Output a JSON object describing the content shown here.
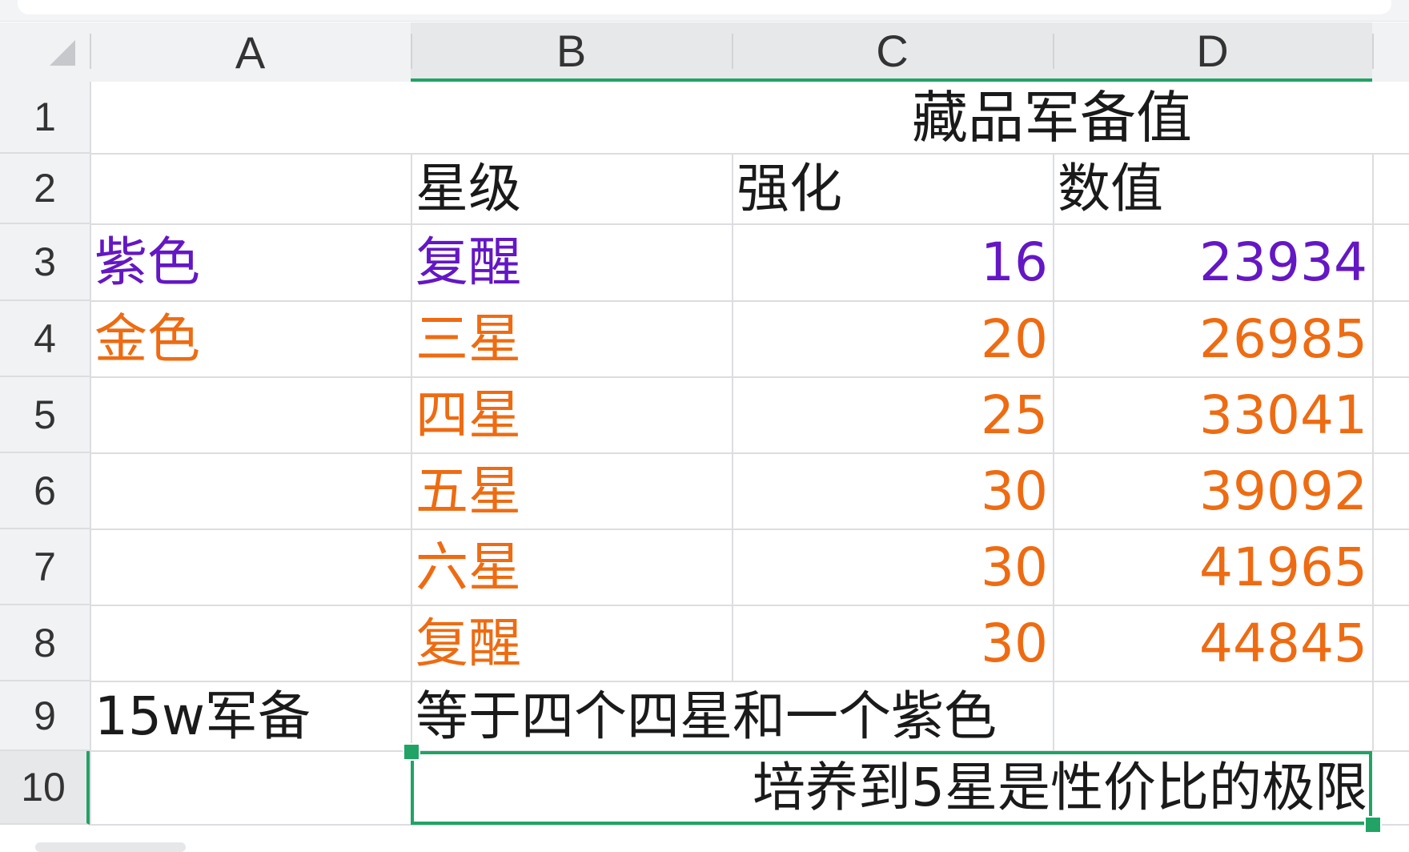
{
  "spreadsheet": {
    "columns": [
      "A",
      "B",
      "C",
      "D"
    ],
    "rows": [
      "1",
      "2",
      "3",
      "4",
      "5",
      "6",
      "7",
      "8",
      "9",
      "10"
    ],
    "selected_range": "B10:D10",
    "cells": {
      "title_merged_C1_D1": "藏品军备值",
      "B2": "星级",
      "C2": "强化",
      "D2": "数值",
      "A3": "紫色",
      "B3": "复醒",
      "C3": "16",
      "D3": "23934",
      "A4": "金色",
      "B4": "三星",
      "C4": "20",
      "D4": "26985",
      "B5": "四星",
      "C5": "25",
      "D5": "33041",
      "B6": "五星",
      "C6": "30",
      "D6": "39092",
      "B7": "六星",
      "C7": "30",
      "D7": "41965",
      "B8": "复醒",
      "C8": "30",
      "D8": "44845",
      "A9": "15w军备",
      "B9": "等于四个四星和一个紫色",
      "B10_merged": "培养到5星是性价比的极限"
    },
    "colors": {
      "purple": "#6417c4",
      "orange": "#ee6b12",
      "selection": "#21a366",
      "text": "#1a1a1a"
    }
  }
}
